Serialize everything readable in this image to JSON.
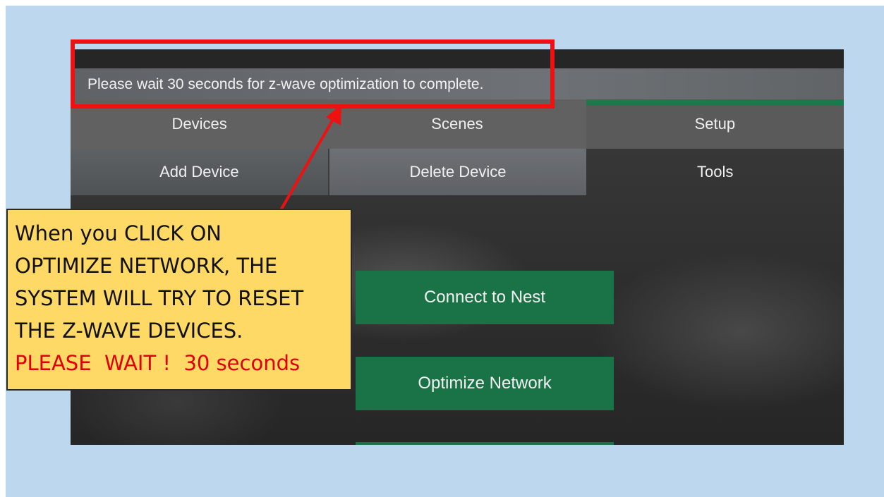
{
  "status": {
    "message": "Please wait 30 seconds for z-wave optimization to complete."
  },
  "tabs": [
    {
      "label": "Devices"
    },
    {
      "label": "Scenes"
    },
    {
      "label": "Setup",
      "active": true
    }
  ],
  "subtabs": [
    {
      "label": "Add Device"
    },
    {
      "label": "Delete Device"
    },
    {
      "label": "Tools"
    }
  ],
  "buttons": {
    "connect_nest": "Connect to Nest",
    "optimize_network": "Optimize Network"
  },
  "callout": {
    "lines": [
      "When you CLICK ON",
      "OPTIMIZE NETWORK, THE",
      "SYSTEM WILL TRY TO RESET",
      "THE Z-WAVE DEVICES."
    ],
    "warning": "PLEASE  WAIT !  30 seconds"
  },
  "colors": {
    "slide_background": "#bdd7ee",
    "accent_green": "#1a7346",
    "highlight_red": "#ee1111",
    "callout_yellow": "#ffd966",
    "warning_red": "#e00000"
  }
}
